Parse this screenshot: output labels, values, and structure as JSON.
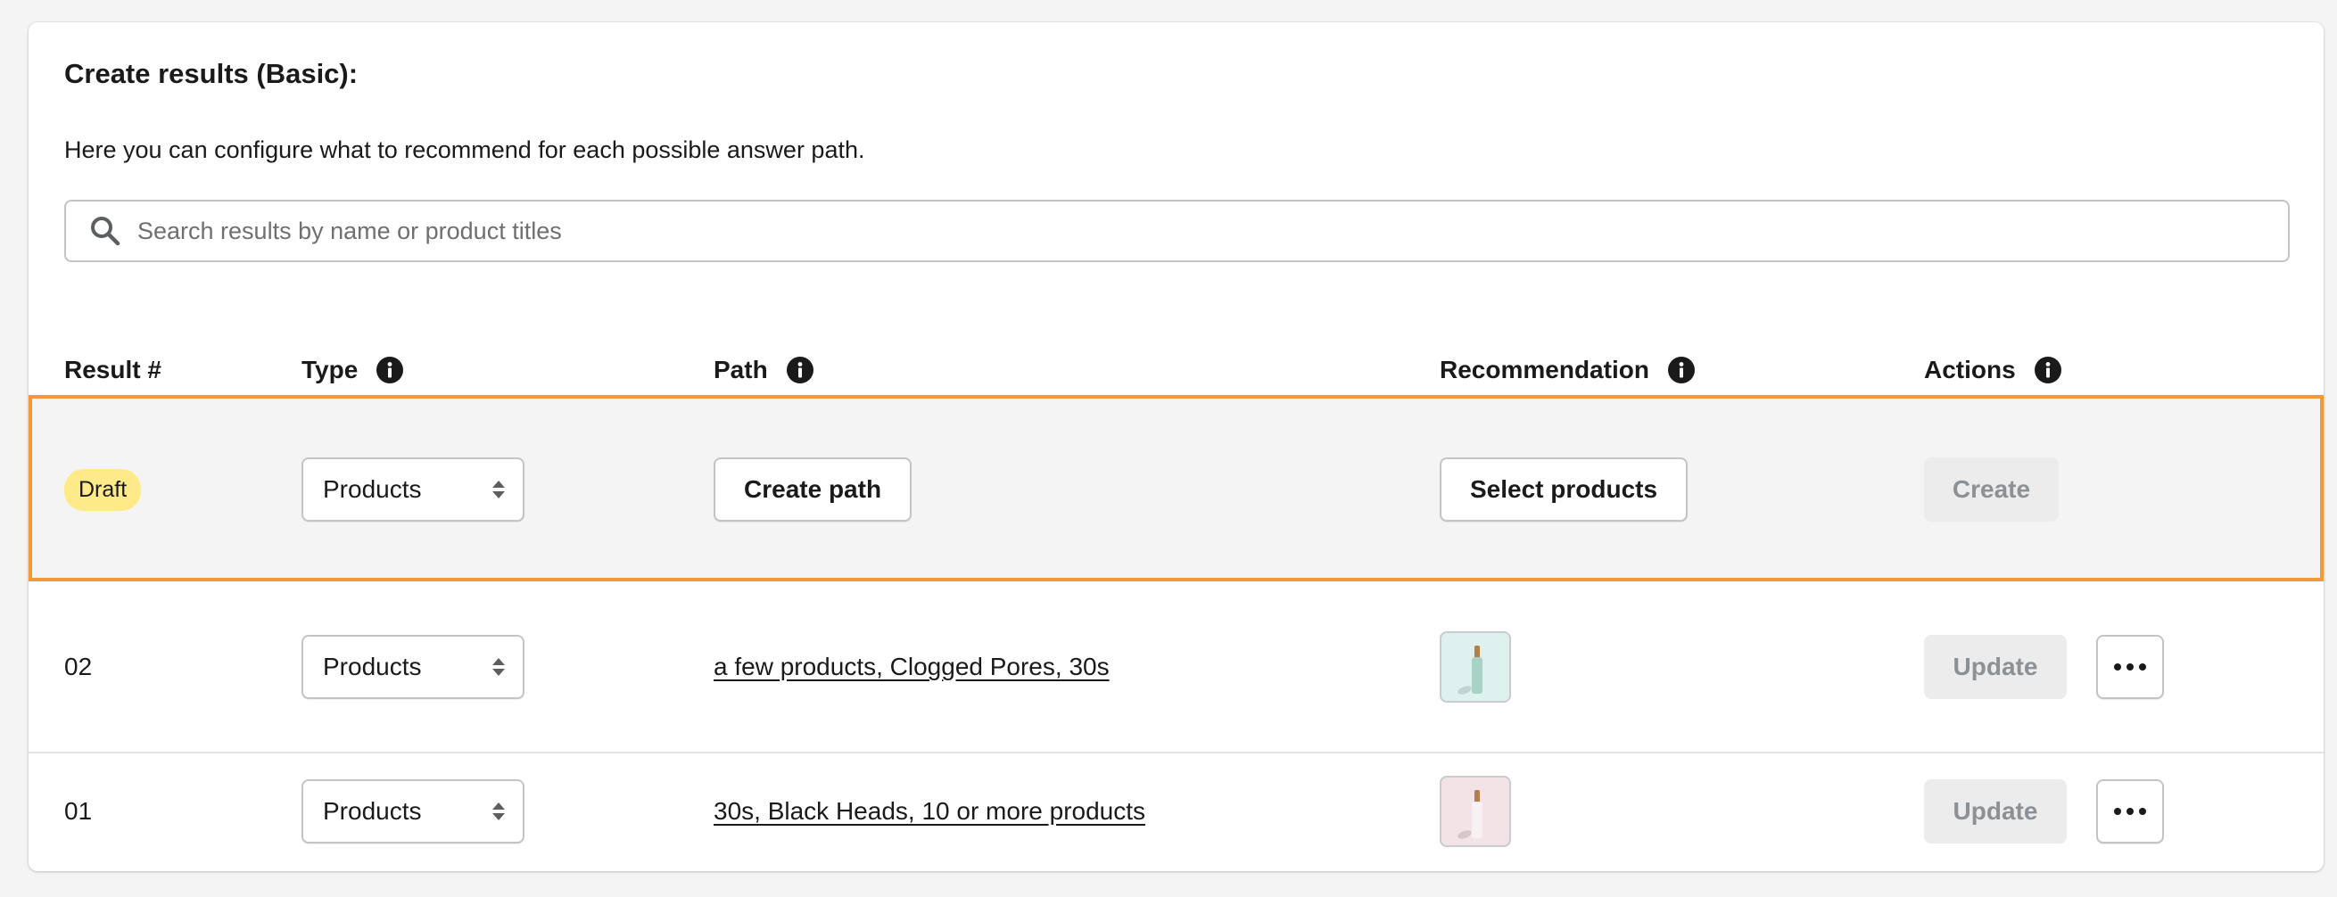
{
  "card": {
    "title": "Create results (Basic):",
    "description": "Here you can configure what to recommend for each possible answer path."
  },
  "search": {
    "placeholder": "Search results by name or product titles",
    "icon": "search-icon"
  },
  "table": {
    "headers": {
      "result": "Result #",
      "type": "Type",
      "path": "Path",
      "recommendation": "Recommendation",
      "actions": "Actions"
    },
    "draft": {
      "badge": "Draft",
      "type": "Products",
      "path_button": "Create path",
      "recommendation_button": "Select products",
      "action_button": "Create"
    },
    "rows": [
      {
        "result": "02",
        "type": "Products",
        "path": "a few products, Clogged Pores, 30s",
        "thumb_color": "#dff1ee",
        "bottle_color": "#a9d2c7",
        "action_button": "Update"
      },
      {
        "result": "01",
        "type": "Products",
        "path": "30s, Black Heads, 10 or more products",
        "thumb_color": "#f3e2e6",
        "bottle_color": "#f8f1f3",
        "action_button": "Update"
      }
    ]
  },
  "colors": {
    "draft_highlight_border": "#f3993a",
    "draft_badge_bg": "#ffea8a",
    "disabled_button_bg": "#ececec"
  }
}
